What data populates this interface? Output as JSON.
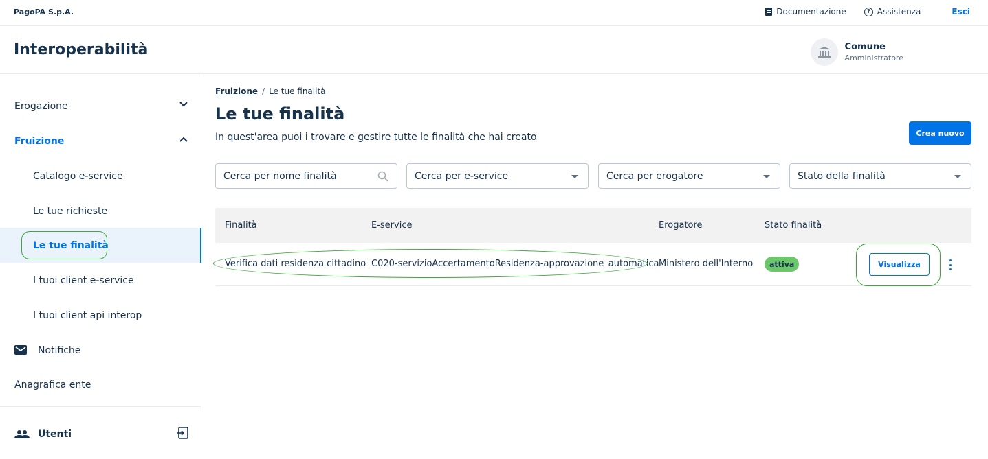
{
  "topbar": {
    "company": "PagoPA S.p.A.",
    "links": {
      "documentation": "Documentazione",
      "assistance": "Assistenza",
      "logout": "Esci"
    }
  },
  "product": {
    "title": "Interoperabilità",
    "party_name": "Comune",
    "party_role": "Amministratore"
  },
  "sidebar": {
    "items": [
      {
        "label": "Erogazione"
      },
      {
        "label": "Fruizione"
      },
      {
        "label": "Catalogo e-service"
      },
      {
        "label": "Le tue richieste"
      },
      {
        "label": "Le tue finalità"
      },
      {
        "label": "I tuoi client e-service"
      },
      {
        "label": "I tuoi client api interop"
      },
      {
        "label": "Notifiche"
      },
      {
        "label": "Anagrafica ente"
      }
    ],
    "footer": {
      "label": "Utenti"
    }
  },
  "breadcrumb": {
    "parent": "Fruizione",
    "separator": "/",
    "current": "Le tue finalità"
  },
  "page": {
    "title": "Le tue finalità",
    "description": "In quest'area puoi i trovare e gestire tutte le finalità che hai creato",
    "create_button": "Crea nuovo"
  },
  "filters": {
    "name_placeholder": "Cerca per nome finalità",
    "eservice": "Cerca per e-service",
    "provider": "Cerca per erogatore",
    "status": "Stato della finalità"
  },
  "table": {
    "headers": [
      "Finalità",
      "E-service",
      "Erogatore",
      "Stato finalità"
    ],
    "rows": [
      {
        "purpose": "Verifica dati residenza cittadino",
        "eservice": "C020-servizioAccertamentoResidenza-approvazione_automatica",
        "provider": "Ministero dell'Interno",
        "status": "attiva",
        "action": "Visualizza"
      }
    ]
  },
  "colors": {
    "primary": "#0073e6",
    "text": "#17324d",
    "status_active": "#6cc66a",
    "highlight": "#3aa935"
  }
}
